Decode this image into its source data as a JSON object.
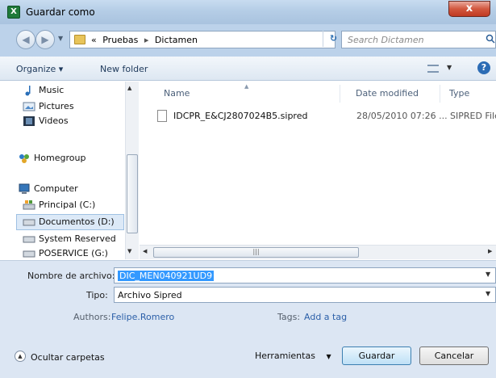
{
  "window": {
    "title": "Guardar como",
    "close_glyph": "x"
  },
  "nav": {
    "breadcrumb": [
      "Pruebas",
      "Dictamen"
    ],
    "breadcrumb_prefix": "«",
    "search_placeholder": "Search Dictamen"
  },
  "toolbar": {
    "organize": "Organize ▾",
    "new_folder": "New folder"
  },
  "sidebar": {
    "items": [
      {
        "label": "Music",
        "icon": "music-note-icon"
      },
      {
        "label": "Pictures",
        "icon": "pictures-icon"
      },
      {
        "label": "Videos",
        "icon": "videos-icon"
      },
      {
        "label": "Homegroup",
        "icon": "homegroup-icon"
      },
      {
        "label": "Computer",
        "icon": "computer-icon"
      },
      {
        "label": "Principal (C:)",
        "icon": "drive-c-icon"
      },
      {
        "label": "Documentos (D:)",
        "icon": "drive-d-icon"
      },
      {
        "label": "System Reserved",
        "icon": "drive-icon"
      },
      {
        "label": "POSERVICE (G:)",
        "icon": "drive-icon"
      }
    ],
    "selected_index": 6
  },
  "list": {
    "columns": [
      "Name",
      "Date modified",
      "Type"
    ],
    "files": [
      {
        "name": "IDCPR_E&CJ2807024B5.sipred",
        "date": "28/05/2010 07:26 ...",
        "type": "SIPRED File"
      }
    ]
  },
  "form": {
    "filename_label": "Nombre de archivo:",
    "filename_value": "DIC_MEN040921UD9",
    "type_label": "Tipo:",
    "type_value": "Archivo Sipred",
    "authors_label": "Authors:",
    "authors_value": "Felipe.Romero",
    "tags_label": "Tags:",
    "tags_value": "Add a tag"
  },
  "buttons": {
    "hide_folders": "Ocultar carpetas",
    "tools": "Herramientas",
    "save": "Guardar",
    "cancel": "Cancelar"
  },
  "colors": {
    "title_gradient": "#b5cde6",
    "selection": "#3399ff",
    "close": "#c03a22"
  }
}
